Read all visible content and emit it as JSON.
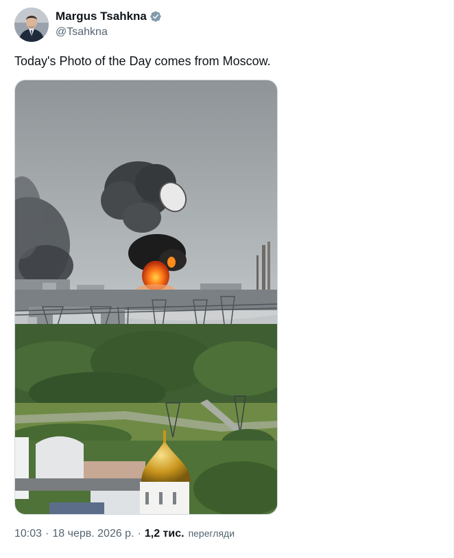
{
  "author": {
    "display_name": "Margus Tsahkna",
    "handle": "@Tsahkna",
    "verified": true,
    "verified_color": "#829aab"
  },
  "tweet": {
    "text": "Today's Photo of the Day comes from Moscow."
  },
  "media": {
    "type": "photo",
    "scene": "explosion-over-industrial-area"
  },
  "meta": {
    "time": "10:03",
    "date": "18 черв. 2026 р.",
    "views_count": "1,2 тис.",
    "views_label": "перегляди",
    "separator": "·"
  },
  "colors": {
    "text_primary": "#0f1419",
    "text_secondary": "#536471",
    "border": "#cfd9de"
  }
}
